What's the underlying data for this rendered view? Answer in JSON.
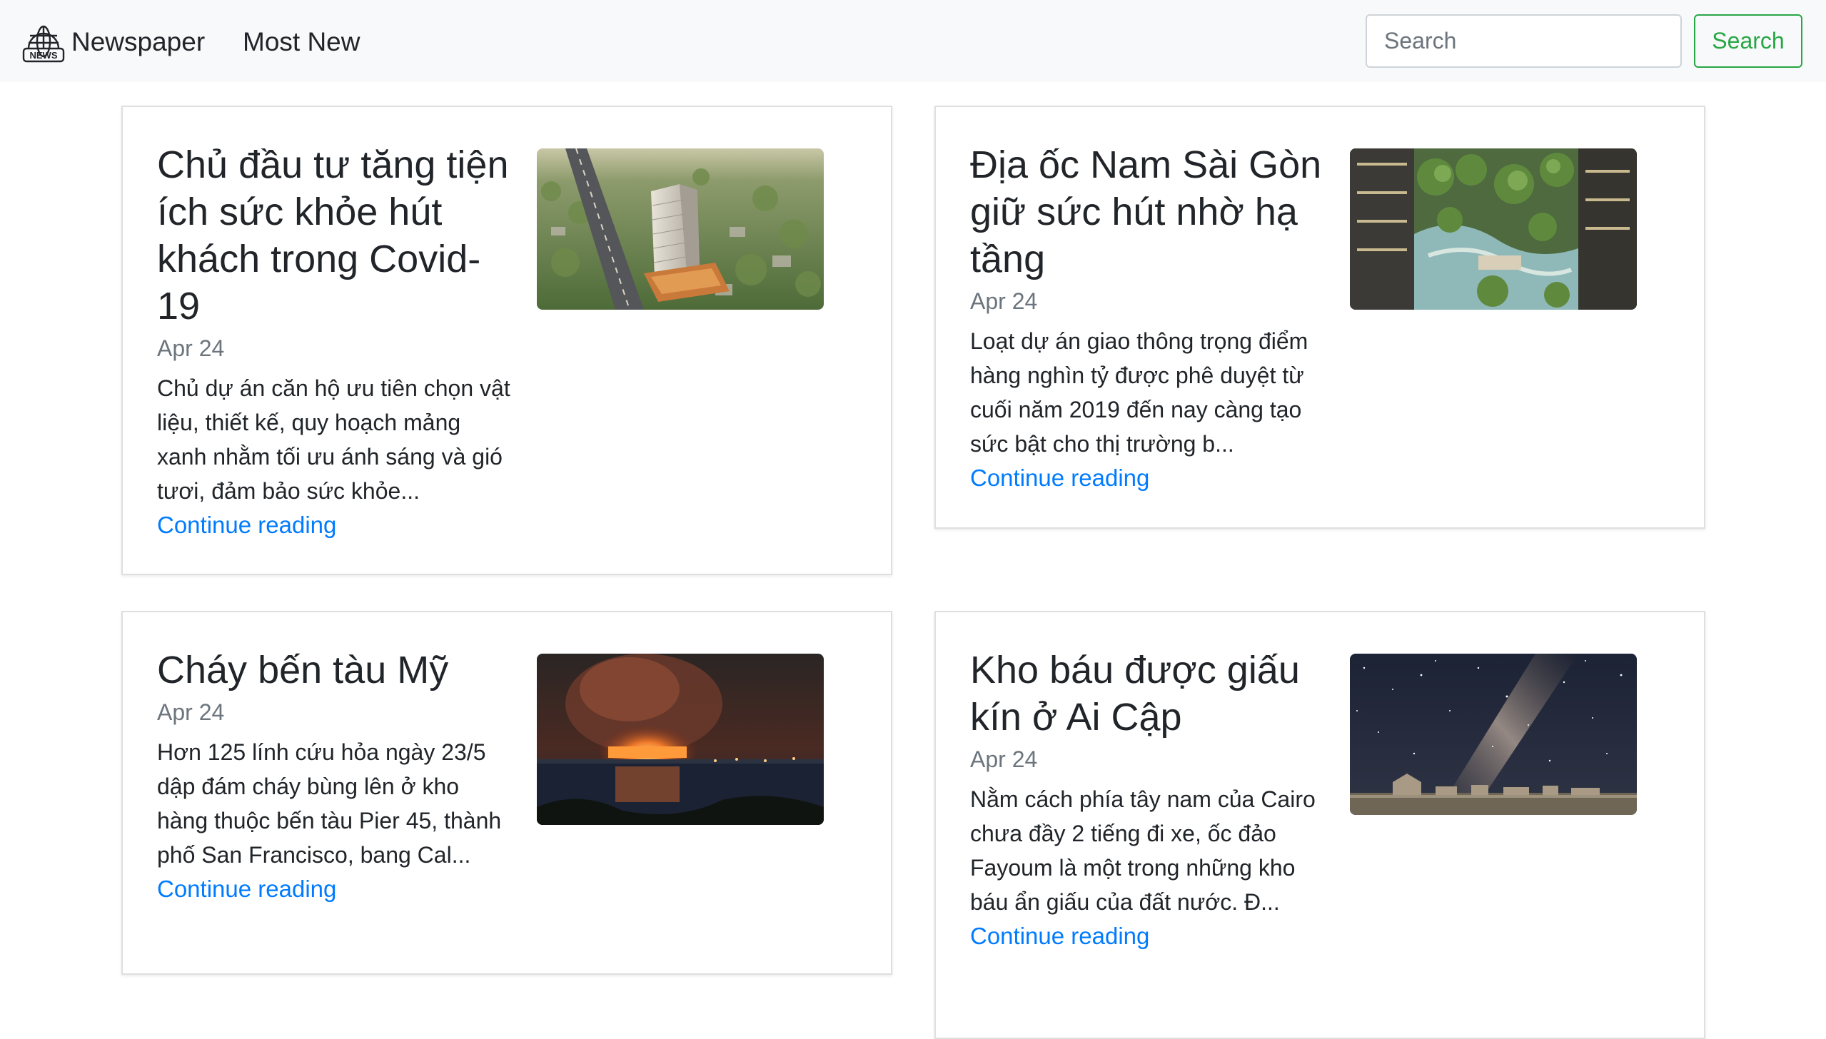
{
  "navbar": {
    "brand": "Newspaper",
    "logo_text": "NEWS",
    "link_most_new": "Most New",
    "search_placeholder": "Search",
    "search_button": "Search"
  },
  "articles": [
    {
      "title": "Chủ đầu tư tăng tiện ích sức khỏe hút khách trong Covid-19",
      "date": "Apr 24",
      "summary": "Chủ dự án căn hộ ưu tiên chọn vật liệu, thiết kế, quy hoạch mảng xanh nhằm tối ưu ánh sáng và gió tươi, đảm bảo sức khỏe...",
      "link": "Continue reading",
      "image": "apartment-tower-aerial"
    },
    {
      "title": "Địa ốc Nam Sài Gòn giữ sức hút nhờ hạ tầng",
      "date": "Apr 24",
      "summary": "Loạt dự án giao thông trọng điểm hàng nghìn tỷ được phê duyệt từ cuối năm 2019 đến nay càng tạo sức bật cho thị trường b...",
      "link": "Continue reading",
      "image": "green-resort-courtyard"
    },
    {
      "title": "Cháy bến tàu Mỹ",
      "date": "Apr 24",
      "summary": "Hơn 125 lính cứu hỏa ngày 23/5 dập đám cháy bùng lên ở kho hàng thuộc bến tàu Pier 45, thành phố San Francisco, bang Cal...",
      "link": "Continue reading",
      "image": "pier-fire-night"
    },
    {
      "title": "Kho báu được giấu kín ở Ai Cập",
      "date": "Apr 24",
      "summary": "Nằm cách phía tây nam của Cairo chưa đầy 2 tiếng đi xe, ốc đảo Fayoum là một trong những kho báu ẩn giấu của đất nước. Đ...",
      "link": "Continue reading",
      "image": "milky-way-desert"
    }
  ],
  "colors": {
    "navbar_bg": "#f8f9fa",
    "link_blue": "#007bff",
    "success_green": "#28a745",
    "muted_gray": "#6c757d"
  }
}
